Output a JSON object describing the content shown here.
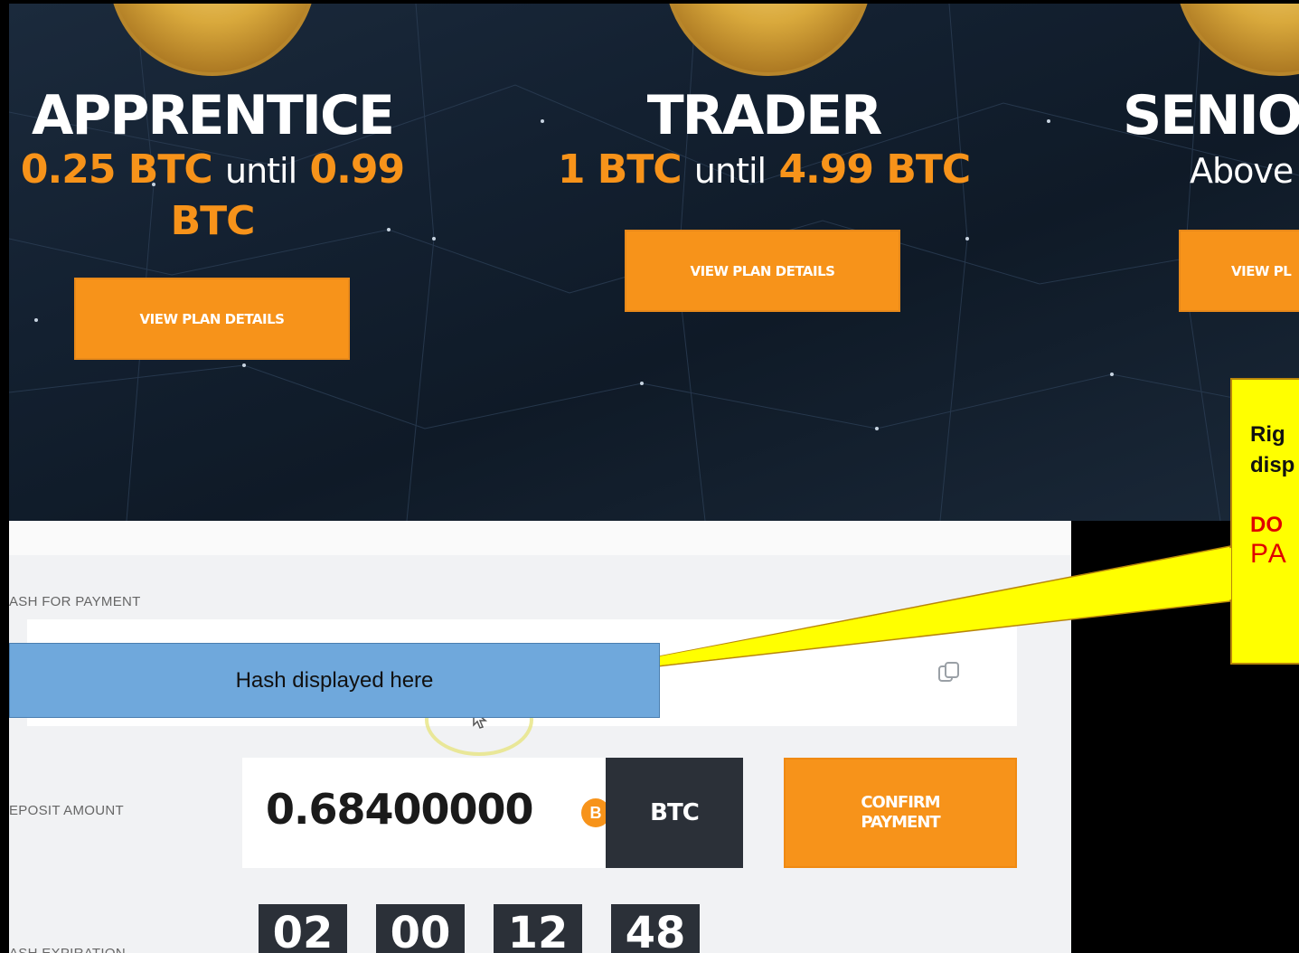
{
  "plans": [
    {
      "name": "APPRENTICE",
      "range_amount_1": "0.25 BTC",
      "range_mid": "until",
      "range_amount_2": "0.99",
      "range_amount_3": "BTC",
      "button": "VIEW PLAN DETAILS"
    },
    {
      "name": "TRADER",
      "range_amount_1": "1 BTC",
      "range_mid": "until",
      "range_amount_2": "4.99 BTC",
      "button": "VIEW PLAN DETAILS"
    },
    {
      "name": "SENIOI",
      "range_text": "Above",
      "button": "VIEW PL"
    }
  ],
  "payment": {
    "hash_label": "ASH FOR PAYMENT",
    "deposit_label": "EPOSIT AMOUNT",
    "deposit_amount": "0.68400000",
    "btc_symbol": "B",
    "currency": "BTC",
    "confirm_line1": "CONFIRM",
    "confirm_line2": "PAYMENT",
    "expiration_label": "ASH EXPIRATION",
    "timer": [
      "02",
      "00",
      "12",
      "48"
    ]
  },
  "annotations": {
    "blue_callout": "Hash displayed here",
    "yellow_line1": "Rig",
    "yellow_line2": "disp",
    "yellow_warn1": "DO",
    "yellow_warn2": "PA"
  },
  "colors": {
    "accent_orange": "#f7931a",
    "dark_box": "#2b3038",
    "callout_yellow": "#ffff00",
    "callout_blue": "#6fa8dc",
    "warning_red": "#e00000"
  }
}
